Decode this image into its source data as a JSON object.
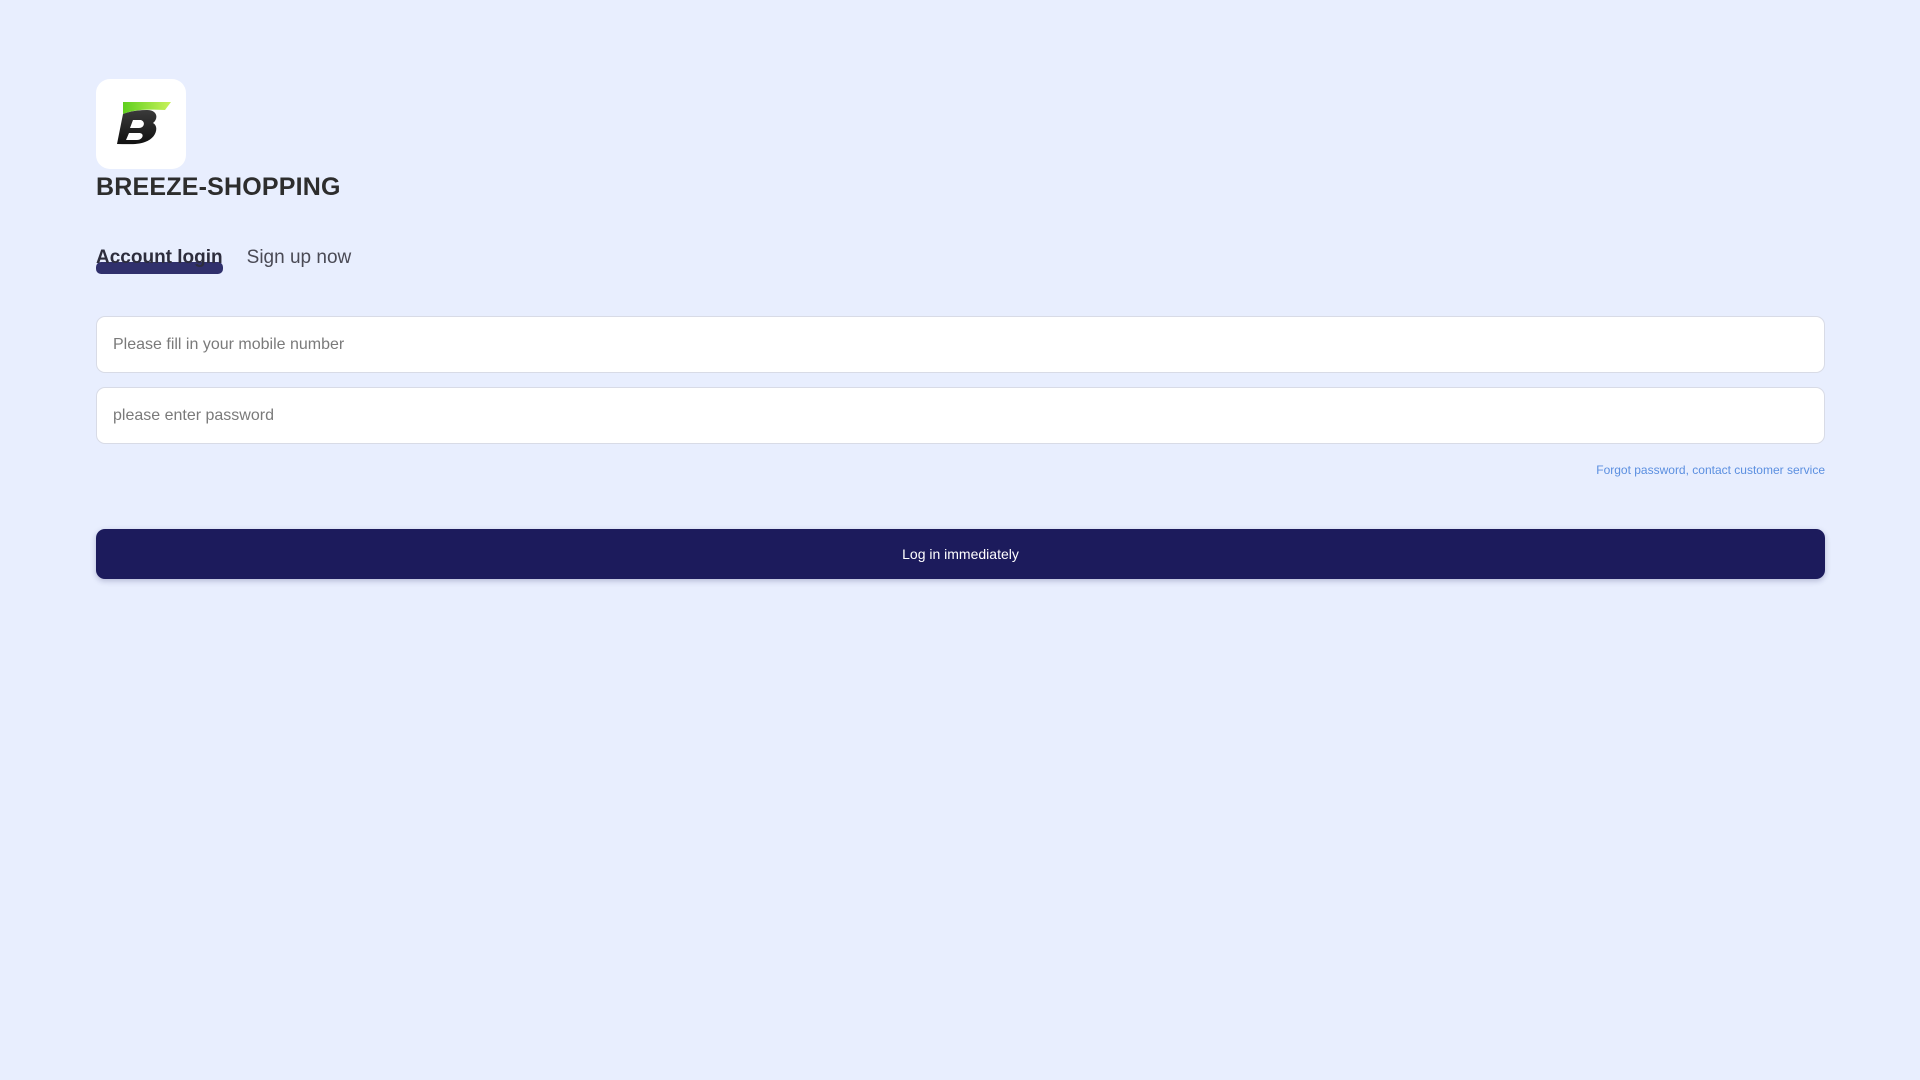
{
  "brand": {
    "name": "BREEZE-SHOPPING",
    "logo_icon": "breeze-b-logo"
  },
  "tabs": [
    {
      "label": "Account login",
      "active": true
    },
    {
      "label": "Sign up now",
      "active": false
    }
  ],
  "form": {
    "mobile_placeholder": "Please fill in your mobile number",
    "mobile_value": "",
    "password_placeholder": "please enter password",
    "password_value": ""
  },
  "forgot_link": "Forgot password, contact customer service",
  "login_button": "Log in immediately",
  "colors": {
    "background": "#e8eefe",
    "primary": "#1c1b5c",
    "link": "#5b8fe0",
    "logo_green": "#7ed321"
  }
}
